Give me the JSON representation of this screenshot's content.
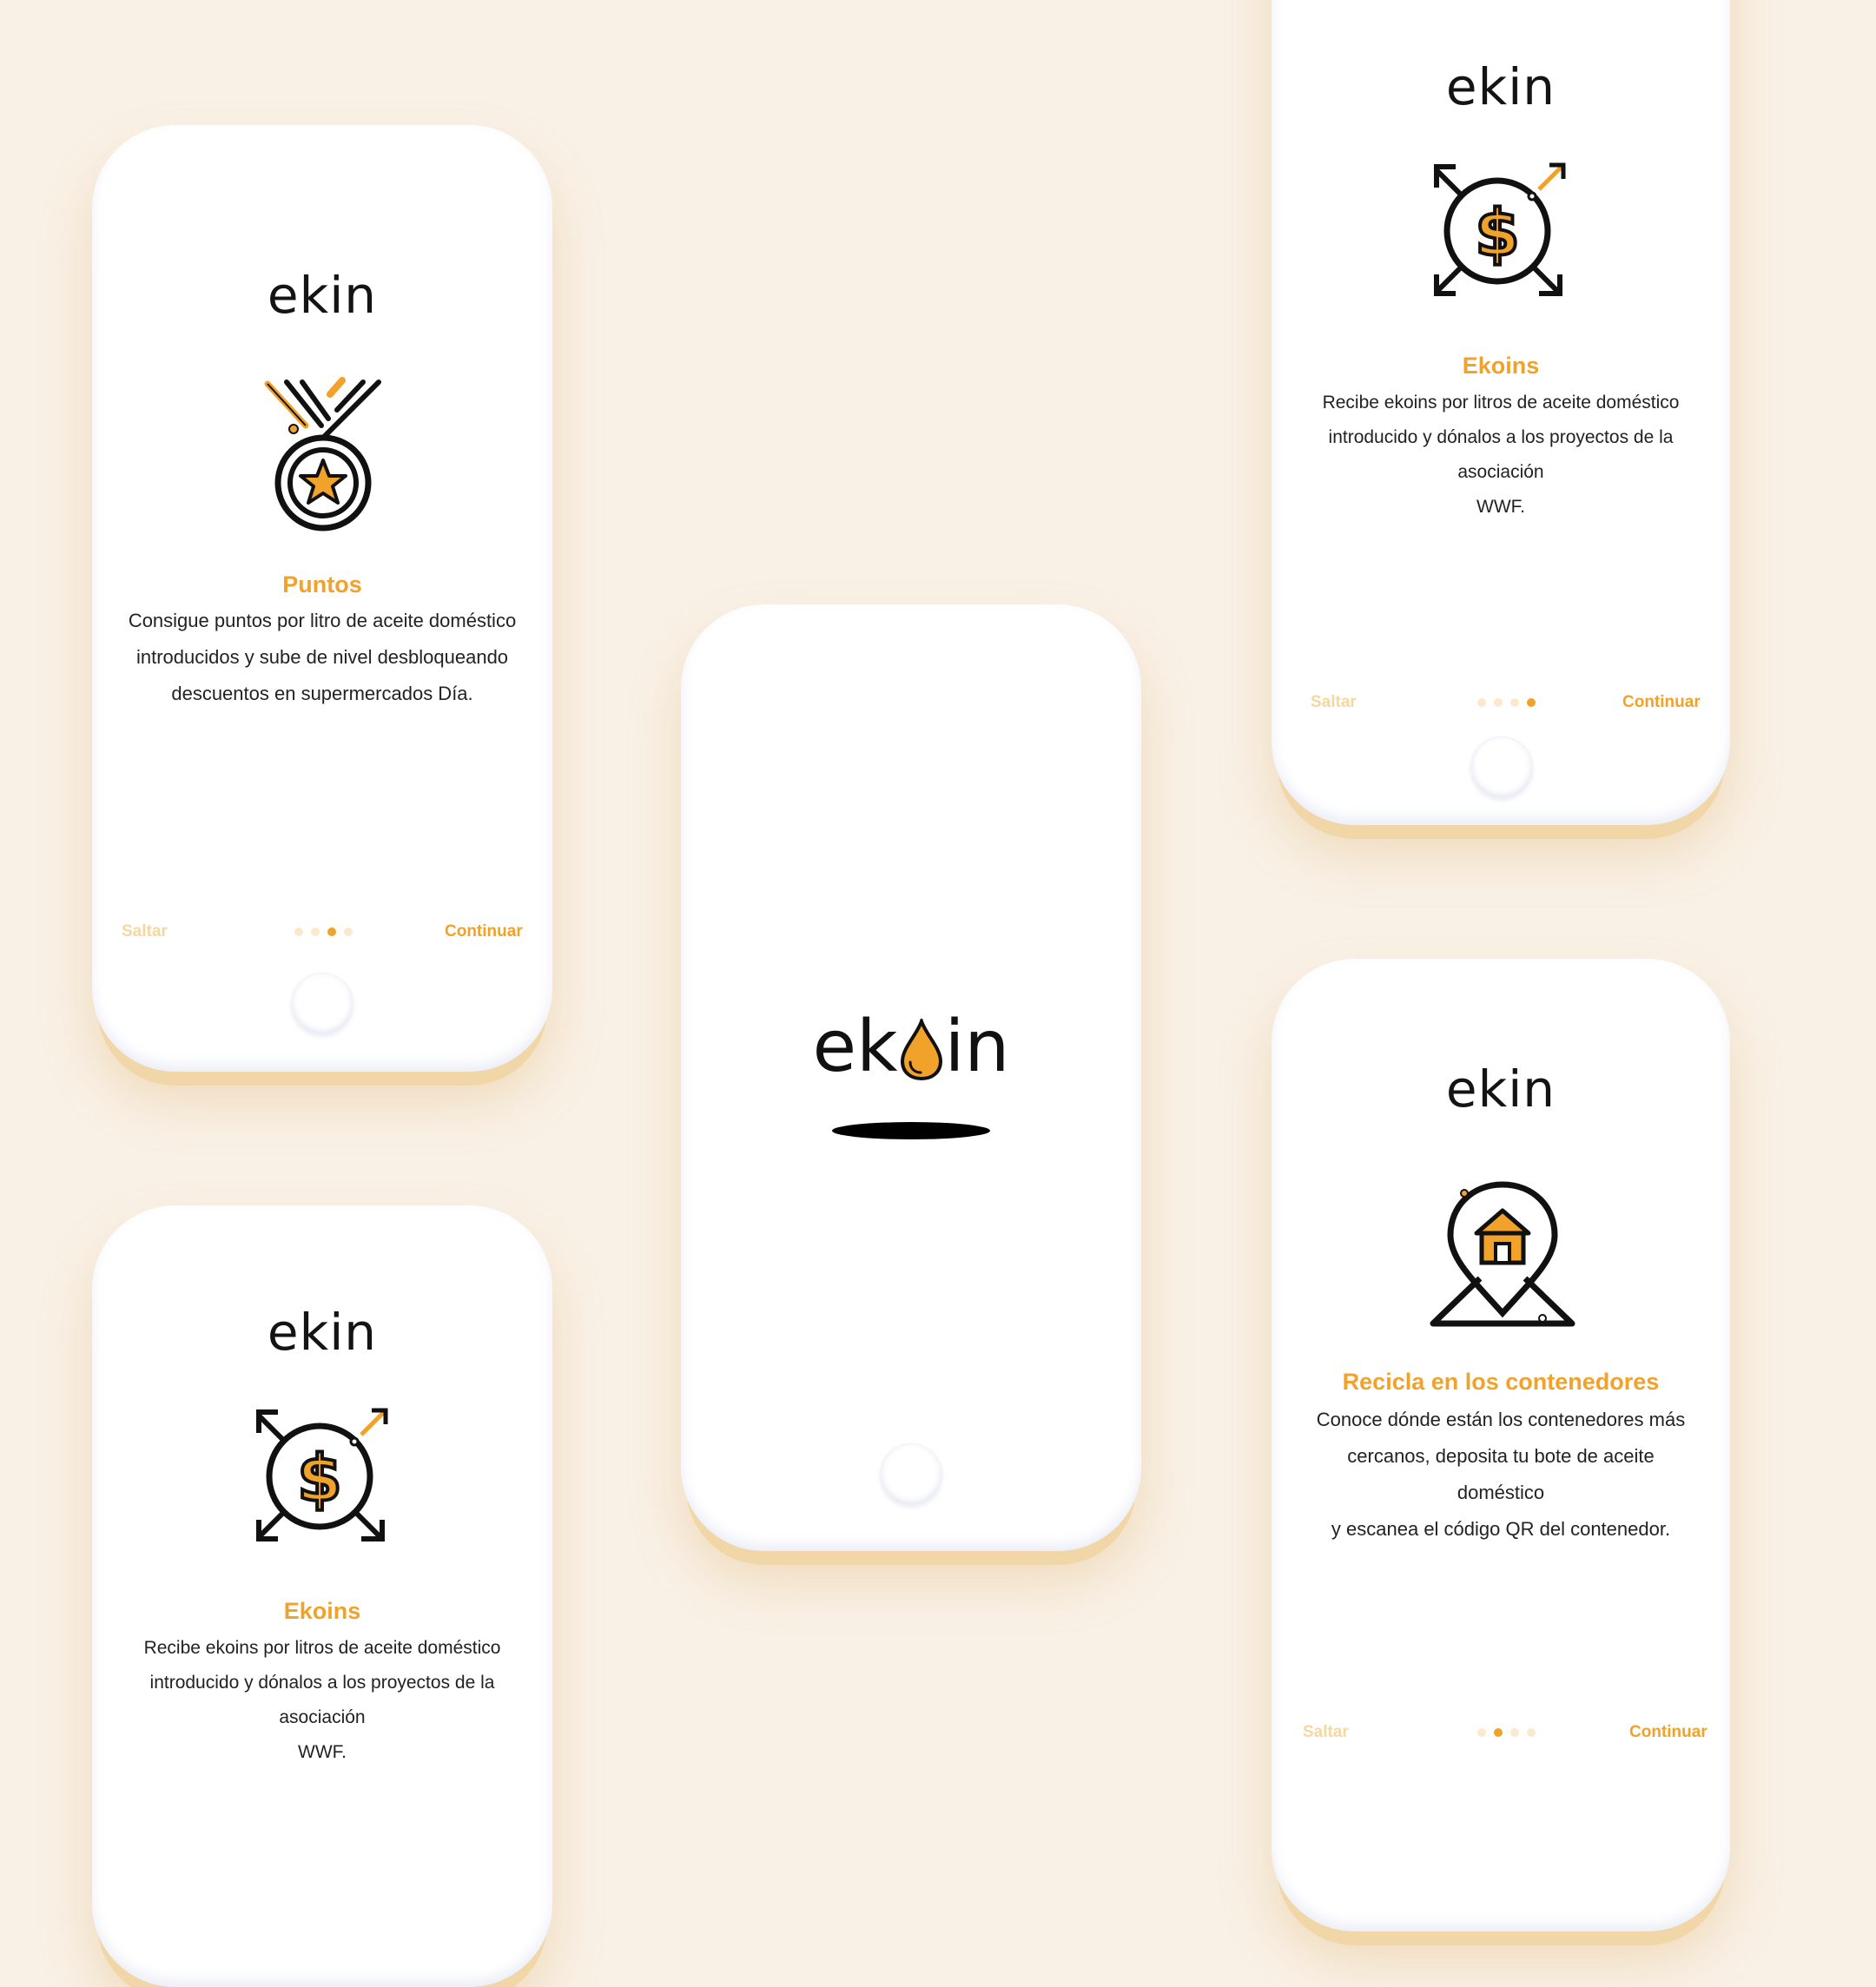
{
  "colors": {
    "background": "#f9f1e6",
    "accent": "#f0a22a",
    "accent_light": "#f6d79f",
    "text": "#222222"
  },
  "app_logo": "ekin",
  "splash_logo": {
    "before": "ek",
    "after": "in",
    "drop_icon": "oil-drop-icon"
  },
  "screens": {
    "puntos": {
      "logo": "ekin",
      "icon": "medal-star-icon",
      "title": "Puntos",
      "lines": [
        "Consigue puntos por litro de aceite doméstico",
        "introducidos y sube de nivel  desbloqueando",
        "descuentos en supermercados Día."
      ],
      "skip": "Saltar",
      "continue": "Continuar",
      "pager": {
        "count": 4,
        "active": 3
      }
    },
    "ekoins_top": {
      "logo": "ekin",
      "icon": "dollar-coin-arrows-icon",
      "title": "Ekoins",
      "lines": [
        "Recibe ekoins por litros de aceite doméstico",
        "introducido y dónalos a los proyectos de la",
        "asociación",
        "WWF."
      ],
      "skip": "Saltar",
      "continue": "Continuar",
      "pager": {
        "count": 4,
        "active": 4
      }
    },
    "ekoins_bottom": {
      "logo": "ekin",
      "icon": "dollar-coin-arrows-icon",
      "title": "Ekoins",
      "lines": [
        "Recibe ekoins por litros de aceite doméstico",
        "introducido y dónalos a los proyectos de la",
        "asociación",
        "WWF."
      ]
    },
    "recicla": {
      "logo": "ekin",
      "icon": "location-pin-house-icon",
      "title": "Recicla en los contenedores",
      "lines": [
        "Conoce dónde están los contenedores más",
        "cercanos, deposita tu bote de aceite doméstico",
        "y escanea el código QR del contenedor."
      ],
      "skip": "Saltar",
      "continue": "Continuar",
      "pager": {
        "count": 4,
        "active": 2
      }
    }
  }
}
